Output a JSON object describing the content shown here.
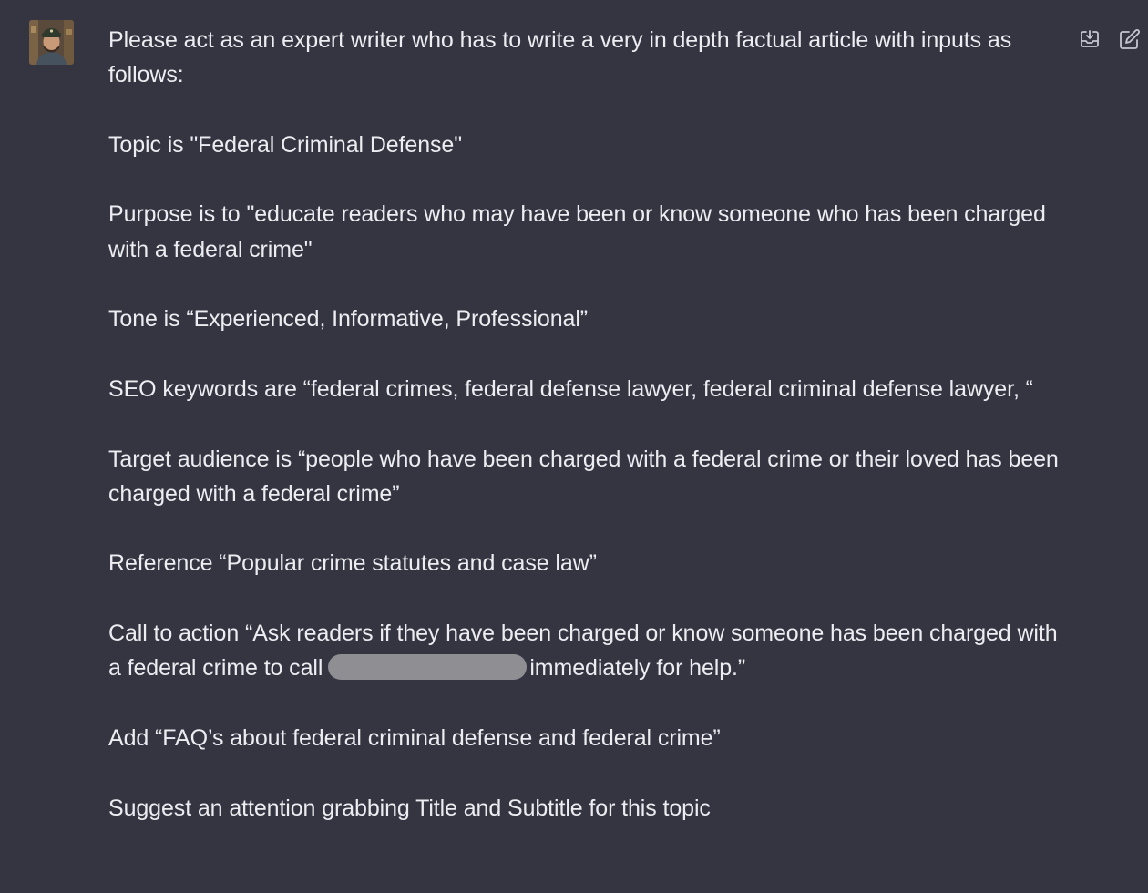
{
  "message": {
    "author_avatar": "user-avatar",
    "paragraphs": [
      "Please act as an expert writer who has to write a very in depth factual article with inputs as follows:",
      "Topic is \"Federal Criminal Defense\"",
      "Purpose is to \"educate readers who may have been or know someone who has been charged with a federal crime\"",
      "Tone is “Experienced, Informative, Professional”",
      "SEO keywords are “federal crimes, federal defense lawyer, federal criminal defense lawyer, “",
      "Target audience is “people who have been charged with a federal crime or their loved has been charged with a federal crime”",
      "Reference “Popular crime statutes and case law”"
    ],
    "cta_before": "Call to action “Ask readers if they have been charged or know someone has been charged with a federal crime to call",
    "cta_after": "immediately for help.”",
    "paragraphs_end": [
      "Add “FAQ’s about federal criminal defense and federal crime”",
      "Suggest an attention grabbing Title and Subtitle for this topic"
    ]
  },
  "actions": {
    "copy_icon": "copy-to-clipboard-icon",
    "edit_icon": "edit-icon"
  },
  "colors": {
    "background": "#343541",
    "text": "#ececf1",
    "icon": "#c5c5d2",
    "redaction": "#8e8e93"
  }
}
